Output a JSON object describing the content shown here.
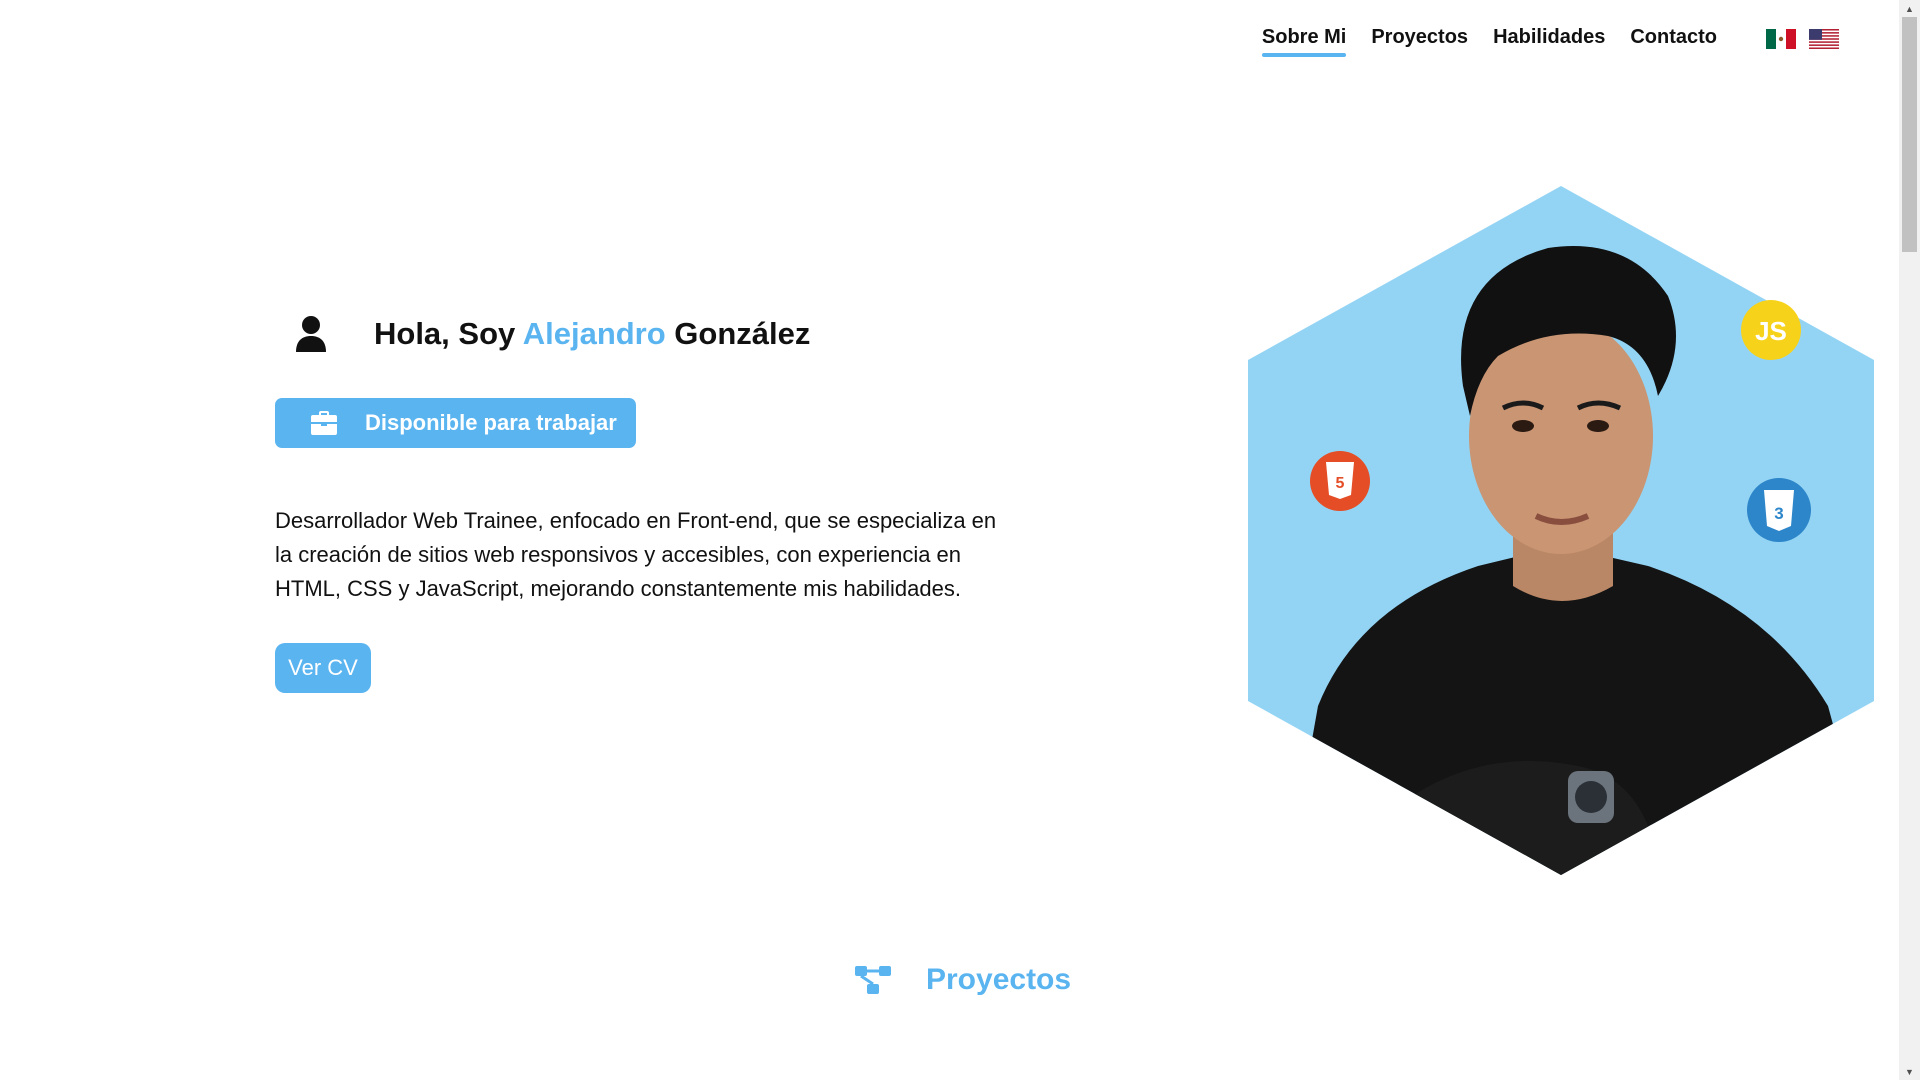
{
  "nav": {
    "items": [
      {
        "label": "Sobre Mi",
        "active": true
      },
      {
        "label": "Proyectos",
        "active": false
      },
      {
        "label": "Habilidades",
        "active": false
      },
      {
        "label": "Contacto",
        "active": false
      }
    ],
    "languages": [
      {
        "icon": "mexico-flag-icon"
      },
      {
        "icon": "usa-flag-icon"
      }
    ]
  },
  "hero": {
    "greeting": "Hola, Soy ",
    "first_name": "Alejandro",
    "last_name": " González",
    "availability": "Disponible para trabajar",
    "description": "Desarrollador Web Trainee, enfocado en Front-end, que se especializa en la creación de sitios web responsivos y accesibles, con experiencia en HTML, CSS y JavaScript, mejorando constantemente mis habilidades.",
    "cv_button": "Ver CV",
    "badges": [
      {
        "icon": "javascript-icon"
      },
      {
        "icon": "html5-icon"
      },
      {
        "icon": "css3-icon"
      }
    ]
  },
  "section": {
    "title": "Proyectos",
    "icon": "diagram-icon"
  },
  "colors": {
    "accent": "#5ab4f0",
    "hex_bg": "#93d4f4",
    "text": "#111111"
  }
}
